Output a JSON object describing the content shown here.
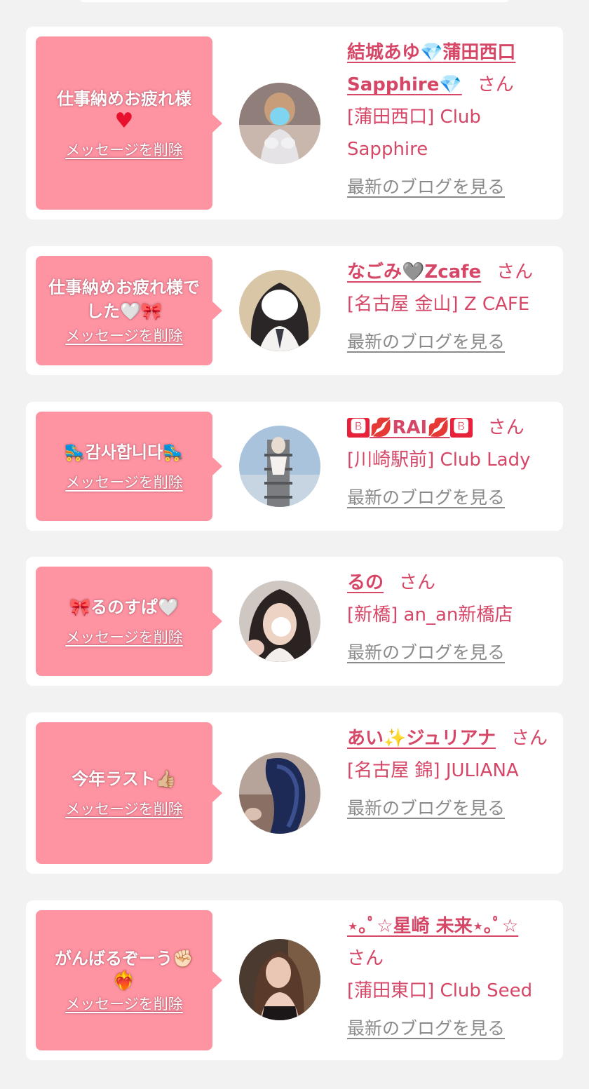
{
  "delete_label": "メッセージを削除",
  "blog_label": "最新のブログを見る",
  "san_label": "さん",
  "messages": [
    {
      "message": "仕事納めお疲れ様",
      "message_emoji": "♥",
      "name_pre": "結城あゆ",
      "name_emoji": "💎",
      "name_post": "蒲田西口Sapphire",
      "name_emoji2": "💎",
      "shop": "[蒲田西口] Club Sapphire"
    },
    {
      "message": "仕事納めお疲れ様でした🤍🎀",
      "name": "なごみ🩶Zcafe",
      "shop": "[名古屋 金山] Z CAFE"
    },
    {
      "message": "🛼감사합니다🛼",
      "name_parts": [
        "🅱",
        "💋RAI💋",
        "🅱"
      ],
      "shop": "[川崎駅前] Club Lady"
    },
    {
      "message": "🎀るのすぱ🤍",
      "name": "るの",
      "shop": "[新橋] an_an新橋店"
    },
    {
      "message": "今年ラスト👍🏼",
      "name": "あい✨ジュリアナ",
      "shop": "[名古屋 錦] JULIANA"
    },
    {
      "message": "がんばるぞーう✊🏻",
      "message_emoji": "❤️‍🔥",
      "name": "⋆｡ﾟ☆星崎 未来⋆｡ﾟ☆",
      "shop": "[蒲田東口] Club Seed"
    }
  ]
}
